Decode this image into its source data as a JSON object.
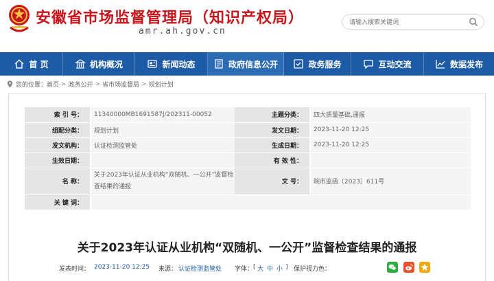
{
  "header": {
    "site_title": "安徽省市场监督管理局（知识产权局）",
    "domain": "amr.ah.gov.cn",
    "search_placeholder": "请输入搜索关键词"
  },
  "nav": {
    "items": [
      {
        "label": "首 页",
        "icon": "home-icon"
      },
      {
        "label": "机构概况",
        "icon": "institution-icon"
      },
      {
        "label": "新闻动态",
        "icon": "news-icon"
      },
      {
        "label": "政府信息公开",
        "icon": "document-icon"
      },
      {
        "label": "政务服务",
        "icon": "service-icon"
      },
      {
        "label": "互动交流",
        "icon": "chat-icon"
      },
      {
        "label": "数据发布",
        "icon": "chart-icon"
      }
    ],
    "active_index": 3
  },
  "breadcrumb": {
    "prefix": "您的位置：",
    "items": [
      "首页",
      "政务公开",
      "省市场监督局",
      "规划计划"
    ],
    "separator": ">"
  },
  "info": {
    "index_label": "索  引  号：",
    "index_value": "11340000MB1691587J/202311-00052",
    "topic_label": "主题分类：",
    "topic_value": "四大质量基础,通报",
    "category_label": "组配分类：",
    "category_value": "规划计划",
    "publish_date_label": "发文日期：",
    "publish_date_value": "2023-11-20 12:25",
    "publisher_label": "发文机构：",
    "publisher_value": "认证检测监管处",
    "created_date_label": "生成日期：",
    "created_date_value": "2023-11-20 12:25",
    "effective_date_label": "生效日期：",
    "effective_date_value": "",
    "validity_label": "有  效  性：",
    "validity_value": "",
    "name_label": "名         称：",
    "name_value": "关于2023年认证从业机构“双随机、一公开”监督检查结果的通报",
    "doc_no_label": "文         号：",
    "doc_no_value": "皖市监函〔2023〕611号",
    "keywords_label": "关  键  词：",
    "keywords_value": ""
  },
  "article": {
    "title": "关于2023年认证从业机构“双随机、一公开”监督检查结果的通报",
    "meta": {
      "time_label": "发表时间：",
      "time_value": "2023-11-20 12:25",
      "source_label": "来源：",
      "source_value": "认证检测监管处",
      "font_label": "字体：",
      "font_bracket_open": "[",
      "font_large": "大",
      "font_medium": "中",
      "font_small": "小",
      "font_bracket_close": "]",
      "protect_label": "保护视力色："
    }
  },
  "colors": {
    "brand_red": "#c8161d",
    "nav_blue": "#1d5ba6",
    "wechat_green": "#2aae3d",
    "weibo_orange": "#e8522c",
    "qzone_yellow": "#f2a80c"
  }
}
